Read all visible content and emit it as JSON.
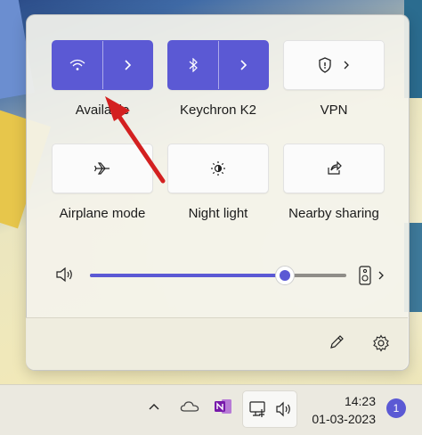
{
  "quick_settings": {
    "tiles": [
      {
        "label": "Available",
        "icon": "wifi-icon",
        "active": true
      },
      {
        "label": "Keychron K2",
        "icon": "bluetooth-icon",
        "active": true
      },
      {
        "label": "VPN",
        "icon": "shield-icon",
        "active": false
      },
      {
        "label": "Airplane mode",
        "icon": "airplane-icon",
        "active": false
      },
      {
        "label": "Night light",
        "icon": "brightness-icon",
        "active": false
      },
      {
        "label": "Nearby sharing",
        "icon": "share-icon",
        "active": false
      }
    ],
    "volume": {
      "level": 0.76,
      "icon": "speaker-icon",
      "output_icon": "speaker-device-icon"
    },
    "footer": {
      "edit_icon": "pencil-icon",
      "settings_icon": "gear-icon"
    }
  },
  "taskbar": {
    "time": "14:23",
    "date": "01-03-2023",
    "notification_count": "1",
    "tray_icons": [
      "chevron-up-icon",
      "onedrive-icon",
      "onenote-icon",
      "network-icon",
      "volume-icon"
    ]
  },
  "colors": {
    "accent": "#5b59d4",
    "annotation_arrow": "#d32020"
  }
}
